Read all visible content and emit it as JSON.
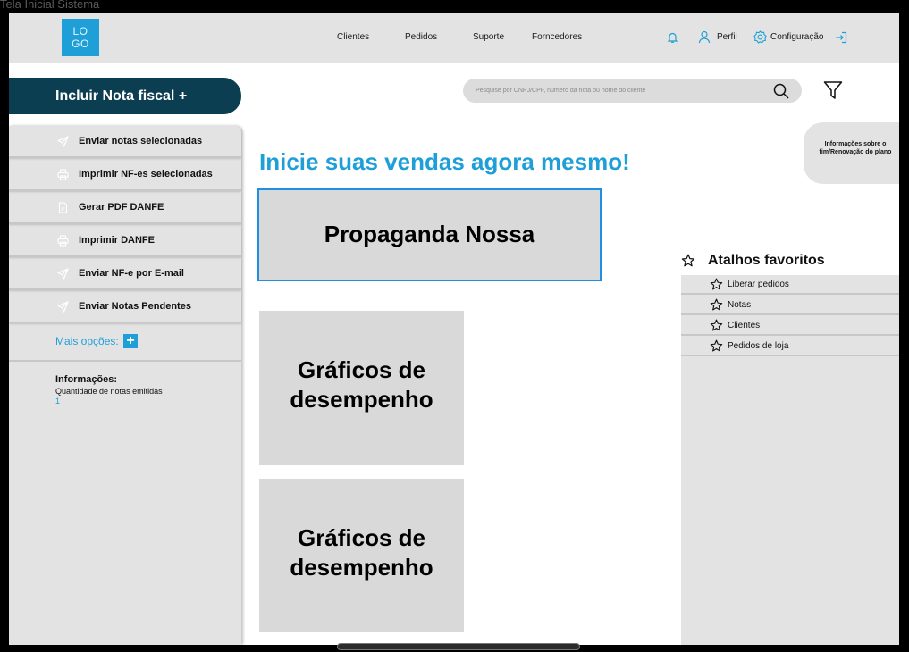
{
  "window_title": "Tela Inicial Sistema",
  "logo": {
    "line1": "LO",
    "line2": "GO"
  },
  "nav": {
    "clientes": "Clientes",
    "pedidos": "Pedidos",
    "suporte": "Suporte",
    "fornecedores": "Forncedores"
  },
  "user_menu": {
    "perfil": "Perfil",
    "configuracao": "Configuração"
  },
  "include_button": "Incluir Nota fiscal +",
  "sidebar": {
    "items": [
      {
        "label": "Enviar notas selecionadas",
        "icon": "send-icon"
      },
      {
        "label": "Imprimir NF-es selecionadas",
        "icon": "printer-icon"
      },
      {
        "label": "Gerar PDF DANFE",
        "icon": "document-icon"
      },
      {
        "label": "Imprimir DANFE",
        "icon": "printer-icon"
      },
      {
        "label": "Enviar NF-e por E-mail",
        "icon": "send-icon"
      },
      {
        "label": "Enviar Notas Pendentes",
        "icon": "send-icon"
      }
    ],
    "more_options": "Mais opções:",
    "more_plus": "+",
    "info_title": "Informações:",
    "info_label": "Quantidade de notas emitidas",
    "info_value": "1"
  },
  "search": {
    "placeholder": "Pesquise por CNPJ/CPF, número da nota ou nome do cliente"
  },
  "main": {
    "headline": "Inicie suas vendas agora mesmo!",
    "promo": "Propaganda Nossa",
    "graph1_line1": "Gráficos de",
    "graph1_line2": "desempenho",
    "graph2_line1": "Gráficos de",
    "graph2_line2": "desempenho"
  },
  "plan_info": "Informações sobre o fim/Renovação do plano",
  "favorites": {
    "title": "Atalhos favoritos",
    "items": [
      "Liberar pedidos",
      "Notas",
      "Clientes",
      "Pedidos de loja"
    ]
  },
  "colors": {
    "accent": "#1f9fd8",
    "dark_button": "#0c3e52",
    "panel": "#e3e3e3"
  }
}
